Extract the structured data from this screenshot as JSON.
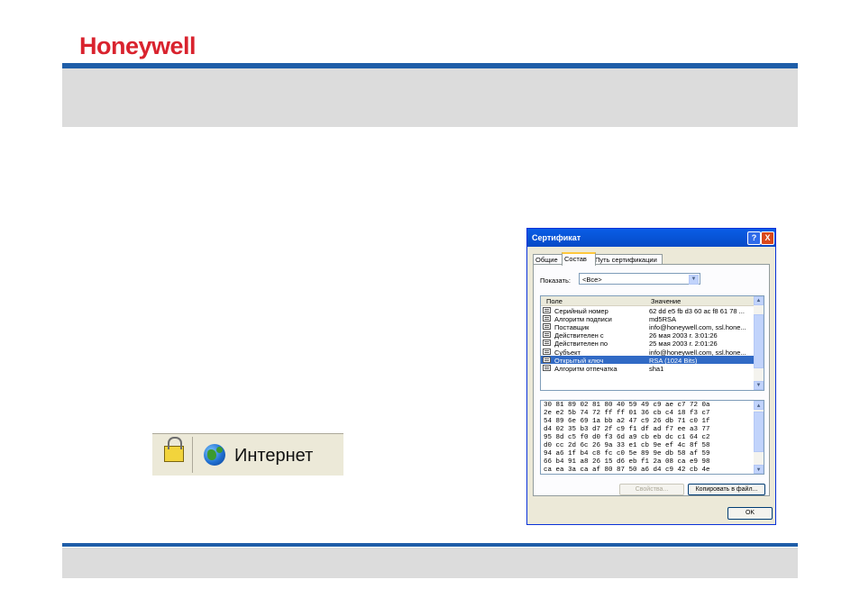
{
  "brand": {
    "logo": "Honeywell"
  },
  "status_bar": {
    "zone_label": "Интернет",
    "icons": [
      "padlock-icon",
      "globe-icon"
    ]
  },
  "dialog": {
    "title": "Сертификат",
    "title_buttons": {
      "help": "?",
      "close": "X"
    },
    "tabs": [
      {
        "label": "Общие",
        "active": false
      },
      {
        "label": "Состав",
        "active": true
      },
      {
        "label": "Путь сертификации",
        "active": false
      }
    ],
    "show_label": "Показать:",
    "show_value": "<Все>",
    "columns": {
      "field": "Поле",
      "value": "Значение"
    },
    "rows": [
      {
        "field": "Серийный номер",
        "value": "62 dd e5 fb d3 60 ac f8 61 78 ...",
        "selected": false
      },
      {
        "field": "Алгоритм подписи",
        "value": "md5RSA",
        "selected": false
      },
      {
        "field": "Поставщик",
        "value": "info@honeywell.com, ssl.hone...",
        "selected": false
      },
      {
        "field": "Действителен с",
        "value": "26 мая 2003 г. 3:01:26",
        "selected": false
      },
      {
        "field": "Действителен по",
        "value": "25 мая 2003 г. 2:01:26",
        "selected": false
      },
      {
        "field": "Субъект",
        "value": "info@honeywell.com, ssl.hone...",
        "selected": false
      },
      {
        "field": "Открытый ключ",
        "value": "RSA (1024 Bits)",
        "selected": true
      },
      {
        "field": "Алгоритм отпечатка",
        "value": "sha1",
        "selected": false
      }
    ],
    "hex_lines": [
      "30 81 89 02 81 80 40 59 49 c9 ae c7 72 0a",
      "2e e2 5b 74 72 ff ff 01 36 cb c4 18 f3 c7",
      "54 89 6e 69 1a bb a2 47 c9 26 db 71 c0 1f",
      "d4 02 35 b3 d7 2f c9 f1 df ad f7 ee a3 77",
      "95 8d c5 f0 d0 f3 6d a9 cb eb dc c1 64 c2",
      "d0 cc 2d 6c 26 9a 33 e1 cb 9e ef 4c 8f 58",
      "94 a6 1f b4 c8 fc c0 5e 89 9e db 58 af 59",
      "66 b4 91 a8 26 15 d6 eb f1 2a 08 ca e9 98",
      "ca ea 3a ca af 80 87 50 a6 d4 c9 42 cb 4e"
    ],
    "properties_button": "Свойства...",
    "copy_button": "Копировать в файл...",
    "ok_button": "OK"
  }
}
